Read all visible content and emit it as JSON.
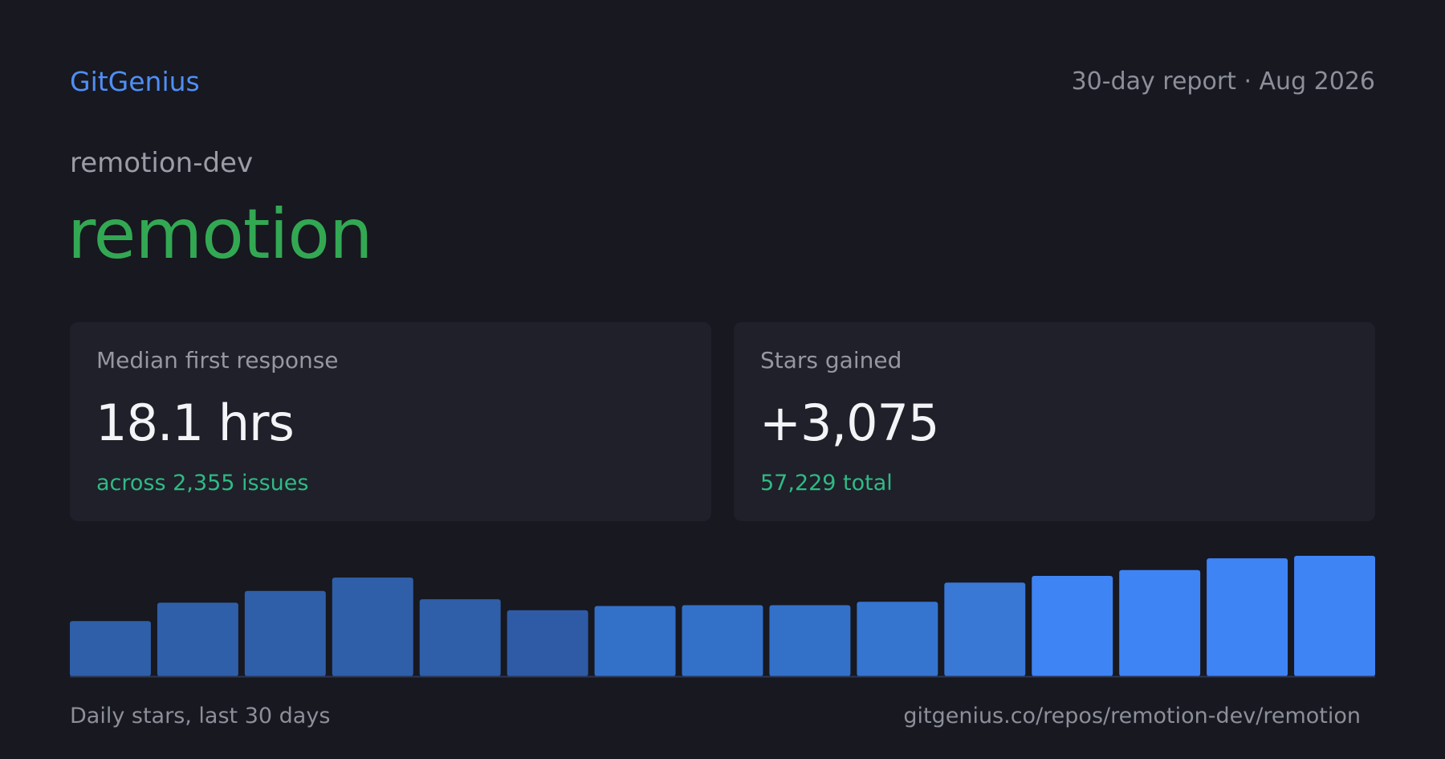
{
  "header": {
    "brand": "GitGenius",
    "report": "30-day report · Aug 2026"
  },
  "repo": {
    "owner": "remotion-dev",
    "name": "remotion"
  },
  "cards": [
    {
      "label": "Median first response",
      "value": "18.1 hrs",
      "sub": "across 2,355 issues"
    },
    {
      "label": "Stars gained",
      "value": "+3,075",
      "sub": "57,229 total"
    }
  ],
  "footer": {
    "caption": "Daily stars, last 30 days",
    "url": "gitgenius.co/repos/remotion-dev/remotion"
  },
  "colors": {
    "background": "#171820",
    "brand": "#4f8ff5",
    "repo_name": "#33a853",
    "accent_sub": "#2fba85",
    "card": "#1f2029"
  },
  "chart_data": {
    "type": "bar",
    "values": [
      66,
      88,
      102,
      118,
      92,
      79,
      84,
      85,
      85,
      89,
      112,
      120,
      127,
      141,
      144
    ],
    "bar_colors": [
      "#2f5fa8",
      "#2f5fa8",
      "#2f5fa8",
      "#2f5fa8",
      "#2f5fa8",
      "#2f5ba6",
      "#3371c9",
      "#3371c9",
      "#3371c9",
      "#3575cf",
      "#3a78d6",
      "#3f84f5",
      "#3f84f5",
      "#3f84f5",
      "#3f84f5"
    ],
    "ylim": [
      0,
      144
    ],
    "grid": false
  }
}
